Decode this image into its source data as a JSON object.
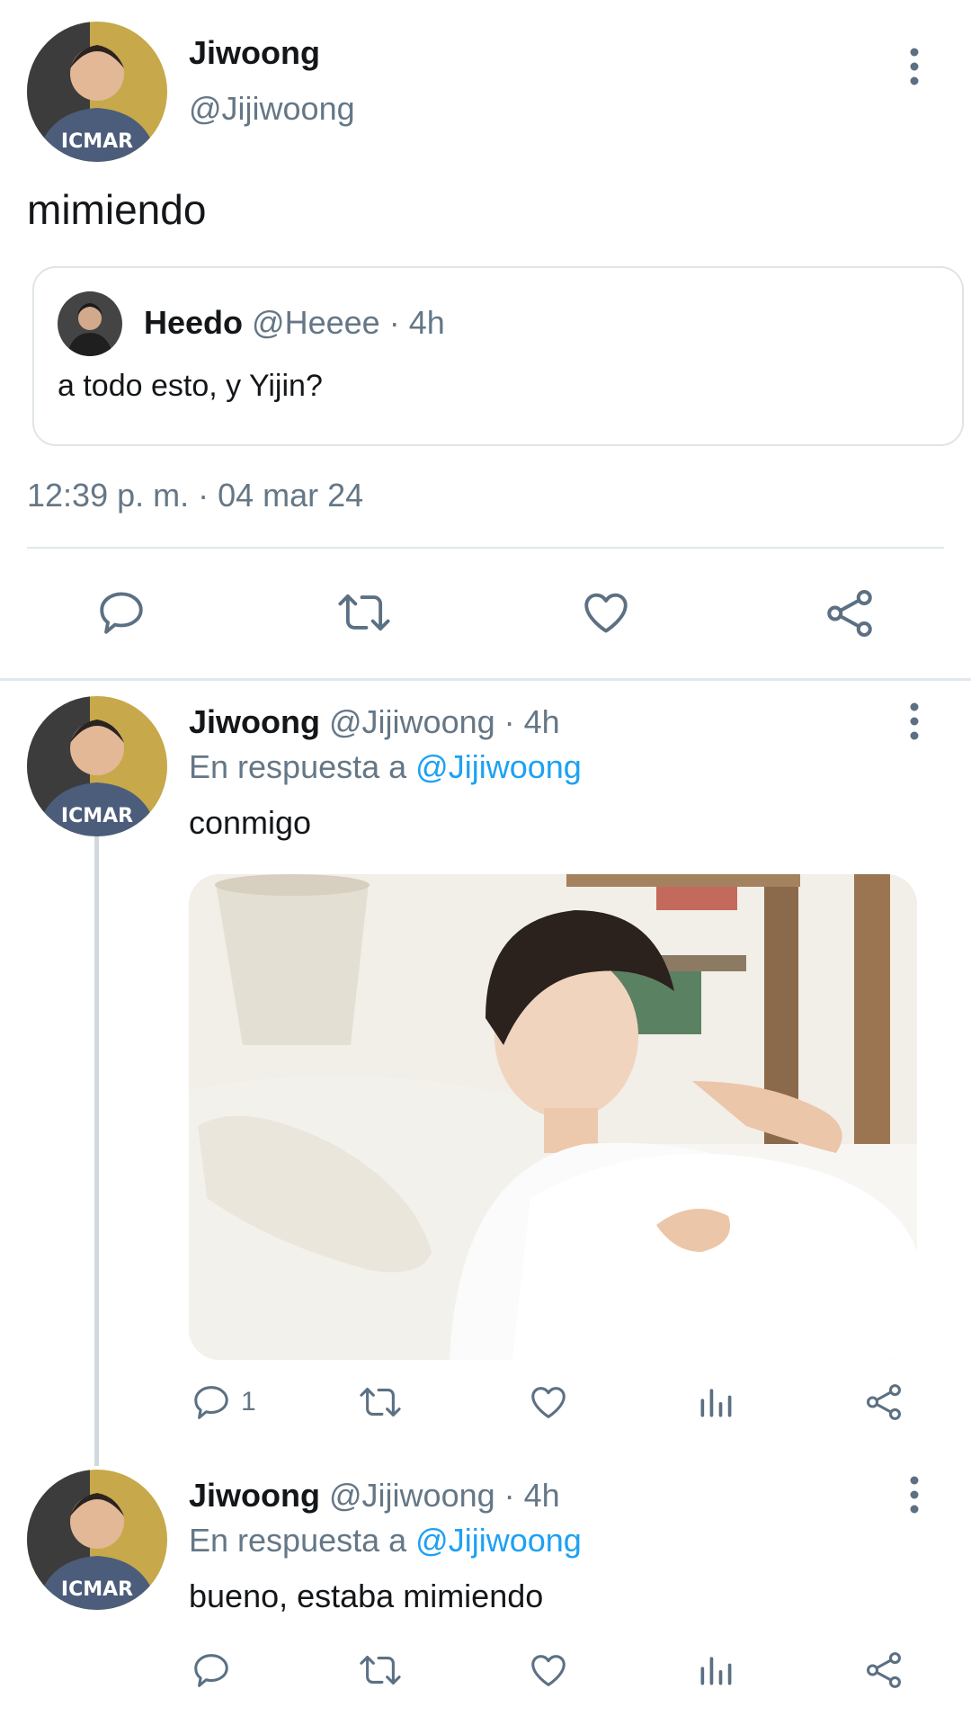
{
  "main_tweet": {
    "author_name": "Jiwoong",
    "author_handle": "@Jijiwoong",
    "text": "mimiendo",
    "quoted": {
      "author_name": "Heedo",
      "author_handle": "@Heeee",
      "time": "· 4h",
      "text": "a todo esto, y Yijin?"
    },
    "timestamp": "12:39 p. m. · 04 mar 24",
    "actions": [
      "reply-icon",
      "retweet-icon",
      "like-icon",
      "share-icon"
    ]
  },
  "replies": [
    {
      "author_name": "Jiwoong",
      "author_handle": "@Jijiwoong",
      "time": "· 4h",
      "reply_prefix": "En respuesta a",
      "reply_to": "@Jijiwoong",
      "text": "conmigo",
      "has_image": true,
      "reply_count": "1"
    },
    {
      "author_name": "Jiwoong",
      "author_handle": "@Jijiwoong",
      "time": "· 4h",
      "reply_prefix": "En respuesta a",
      "reply_to": "@Jijiwoong",
      "text": "bueno, estaba mimiendo",
      "has_image": false,
      "reply_count": ""
    }
  ],
  "colors": {
    "link": "#1da1f2",
    "muted": "#657786",
    "icon": "#5b7083",
    "divider": "#e1e8ed"
  }
}
